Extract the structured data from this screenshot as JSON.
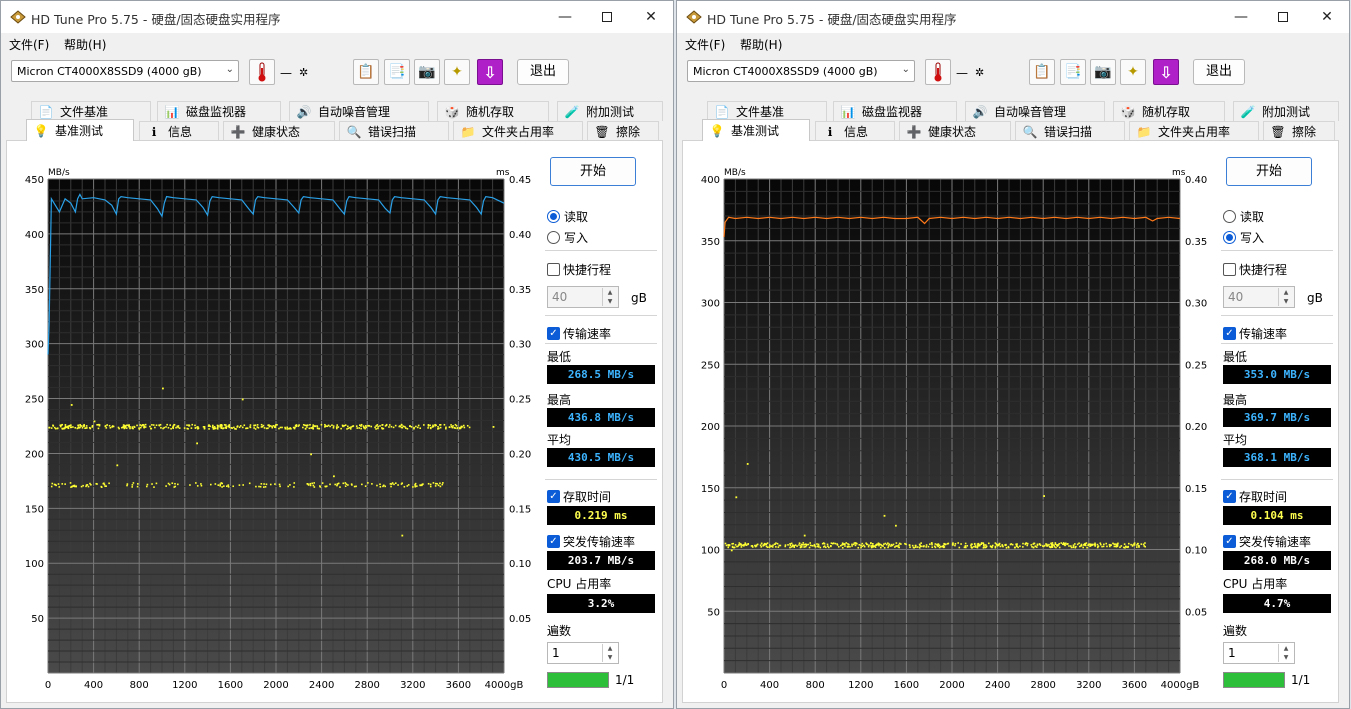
{
  "windows": [
    {
      "title": "HD Tune Pro 5.75 - 硬盘/固态硬盘实用程序",
      "menu": {
        "file": "文件(F)",
        "help": "帮助(H)"
      },
      "drive": "Micron  CT4000X8SSD9 (4000 gB)",
      "temperature": "—",
      "exit_label": "退出",
      "tabs_top": [
        "文件基准",
        "磁盘监视器",
        "自动噪音管理",
        "随机存取",
        "附加测试"
      ],
      "tabs_bottom": [
        "基准测试",
        "信息",
        "健康状态",
        "错误扫描",
        "文件夹占用率",
        "擦除"
      ],
      "start_label": "开始",
      "mode_read": "读取",
      "mode_write": "写入",
      "selected_mode": "read",
      "short_stroke": {
        "label": "快捷行程",
        "checked": false,
        "value": "40",
        "unit": "gB"
      },
      "transfer": {
        "label": "传输速率",
        "checked": true
      },
      "min_label": "最低",
      "min": "268.5 MB/s",
      "max_label": "最高",
      "max": "436.8 MB/s",
      "avg_label": "平均",
      "avg": "430.5 MB/s",
      "access": {
        "label": "存取时间",
        "checked": true,
        "value": "0.219 ms"
      },
      "burst": {
        "label": "突发传输速率",
        "checked": true,
        "value": "203.7 MB/s"
      },
      "cpu": {
        "label": "CPU 占用率",
        "value": "3.2%"
      },
      "passes": {
        "label": "遍数",
        "value": "1",
        "progress_text": "1/1",
        "progress": 1.0
      },
      "chart_data": {
        "type": "line",
        "x_unit": "gB",
        "x_ticks": [
          "0",
          "400",
          "800",
          "1200",
          "1600",
          "2000",
          "2400",
          "2800",
          "3200",
          "3600",
          "4000gB"
        ],
        "xlim": [
          0,
          4000
        ],
        "y_left_label": "MB/s",
        "y_left_ticks": [
          "50",
          "100",
          "150",
          "200",
          "250",
          "300",
          "350",
          "400",
          "450"
        ],
        "y_left_range": [
          0,
          450
        ],
        "y_right_label": "ms",
        "y_right_ticks": [
          "0.05",
          "0.10",
          "0.15",
          "0.20",
          "0.25",
          "0.30",
          "0.35",
          "0.40",
          "0.45"
        ],
        "y_right_range": [
          0,
          0.45
        ],
        "transfer_color": "#2aa1e8",
        "access_color": "#ffff33",
        "transfer_series": {
          "x": [
            0,
            10,
            30,
            100,
            150,
            200,
            240,
            260,
            280,
            300,
            400,
            500,
            560,
            600,
            620,
            640,
            700,
            800,
            900,
            960,
            1000,
            1020,
            1040,
            1100,
            1200,
            1300,
            1360,
            1400,
            1420,
            1440,
            1500,
            1600,
            1700,
            1760,
            1800,
            1820,
            1840,
            1900,
            2000,
            2100,
            2160,
            2200,
            2220,
            2240,
            2300,
            2400,
            2500,
            2560,
            2600,
            2620,
            2640,
            2700,
            2800,
            2900,
            2960,
            3000,
            3020,
            3040,
            3100,
            3200,
            3300,
            3360,
            3400,
            3420,
            3440,
            3500,
            3600,
            3700,
            3760,
            3800,
            3820,
            3840,
            3900,
            4000
          ],
          "y": [
            290,
            318,
            432,
            420,
            432,
            428,
            420,
            432,
            436,
            432,
            433,
            431,
            426,
            418,
            432,
            434,
            433,
            432,
            431,
            423,
            416,
            428,
            434,
            433,
            432,
            431,
            424,
            417,
            430,
            434,
            433,
            432,
            431,
            423,
            418,
            431,
            434,
            433,
            432,
            431,
            424,
            419,
            431,
            434,
            433,
            432,
            431,
            423,
            418,
            430,
            434,
            433,
            432,
            431,
            423,
            419,
            431,
            434,
            433,
            432,
            431,
            424,
            418,
            431,
            434,
            433,
            432,
            431,
            424,
            418,
            430,
            434,
            433,
            428
          ]
        },
        "access_bands": [
          {
            "ms": 0.225,
            "n": 420,
            "x_end": 3700
          },
          {
            "ms": 0.172,
            "n": 170,
            "x_end": 3500
          }
        ],
        "access_outliers": [
          [
            200,
            0.245
          ],
          [
            1000,
            0.26
          ],
          [
            1700,
            0.25
          ],
          [
            1300,
            0.21
          ],
          [
            600,
            0.19
          ],
          [
            2300,
            0.2
          ],
          [
            3100,
            0.126
          ],
          [
            3900,
            0.225
          ],
          [
            400,
            0.23
          ],
          [
            2500,
            0.18
          ]
        ]
      }
    },
    {
      "title": "HD Tune Pro 5.75 - 硬盘/固态硬盘实用程序",
      "menu": {
        "file": "文件(F)",
        "help": "帮助(H)"
      },
      "drive": "Micron  CT4000X8SSD9 (4000 gB)",
      "temperature": "—",
      "exit_label": "退出",
      "tabs_top": [
        "文件基准",
        "磁盘监视器",
        "自动噪音管理",
        "随机存取",
        "附加测试"
      ],
      "tabs_bottom": [
        "基准测试",
        "信息",
        "健康状态",
        "错误扫描",
        "文件夹占用率",
        "擦除"
      ],
      "start_label": "开始",
      "mode_read": "读取",
      "mode_write": "写入",
      "selected_mode": "write",
      "short_stroke": {
        "label": "快捷行程",
        "checked": false,
        "value": "40",
        "unit": "gB"
      },
      "transfer": {
        "label": "传输速率",
        "checked": true
      },
      "min_label": "最低",
      "min": "353.0 MB/s",
      "max_label": "最高",
      "max": "369.7 MB/s",
      "avg_label": "平均",
      "avg": "368.1 MB/s",
      "access": {
        "label": "存取时间",
        "checked": true,
        "value": "0.104 ms"
      },
      "burst": {
        "label": "突发传输速率",
        "checked": true,
        "value": "268.0 MB/s"
      },
      "cpu": {
        "label": "CPU 占用率",
        "value": "4.7%"
      },
      "passes": {
        "label": "遍数",
        "value": "1",
        "progress_text": "1/1",
        "progress": 1.0
      },
      "chart_data": {
        "type": "line",
        "x_unit": "gB",
        "x_ticks": [
          "0",
          "400",
          "800",
          "1200",
          "1600",
          "2000",
          "2400",
          "2800",
          "3200",
          "3600",
          "4000gB"
        ],
        "xlim": [
          0,
          4000
        ],
        "y_left_label": "MB/s",
        "y_left_ticks": [
          "50",
          "100",
          "150",
          "200",
          "250",
          "300",
          "350",
          "400"
        ],
        "y_left_range": [
          0,
          400
        ],
        "y_right_label": "ms",
        "y_right_ticks": [
          "0.05",
          "0.10",
          "0.15",
          "0.20",
          "0.25",
          "0.30",
          "0.35",
          "0.40"
        ],
        "y_right_range": [
          0,
          0.4
        ],
        "transfer_color": "#ff7a1a",
        "access_color": "#ffff33",
        "transfer_series": {
          "x": [
            0,
            10,
            40,
            100,
            200,
            300,
            400,
            500,
            600,
            700,
            800,
            900,
            1000,
            1100,
            1200,
            1300,
            1400,
            1500,
            1600,
            1700,
            1760,
            1800,
            1900,
            2000,
            2100,
            2200,
            2300,
            2400,
            2500,
            2600,
            2700,
            2800,
            2900,
            3000,
            3100,
            3200,
            3300,
            3400,
            3500,
            3600,
            3700,
            3760,
            3800,
            3900,
            4000
          ],
          "y": [
            353,
            365,
            369,
            368,
            369,
            368,
            369,
            368,
            369,
            368,
            369,
            368,
            369,
            368,
            369,
            368,
            369,
            368,
            368,
            369,
            364,
            368,
            369,
            368,
            369,
            368,
            369,
            368,
            369,
            368,
            369,
            368,
            369,
            368,
            369,
            368,
            369,
            368,
            369,
            368,
            369,
            366,
            368,
            369,
            368
          ]
        },
        "access_bands": [
          {
            "ms": 0.104,
            "n": 520,
            "x_end": 3700
          }
        ],
        "access_outliers": [
          [
            100,
            0.143
          ],
          [
            200,
            0.17
          ],
          [
            1400,
            0.128
          ],
          [
            1500,
            0.12
          ],
          [
            2800,
            0.144
          ],
          [
            700,
            0.112
          ],
          [
            60,
            0.1
          ]
        ]
      }
    }
  ]
}
